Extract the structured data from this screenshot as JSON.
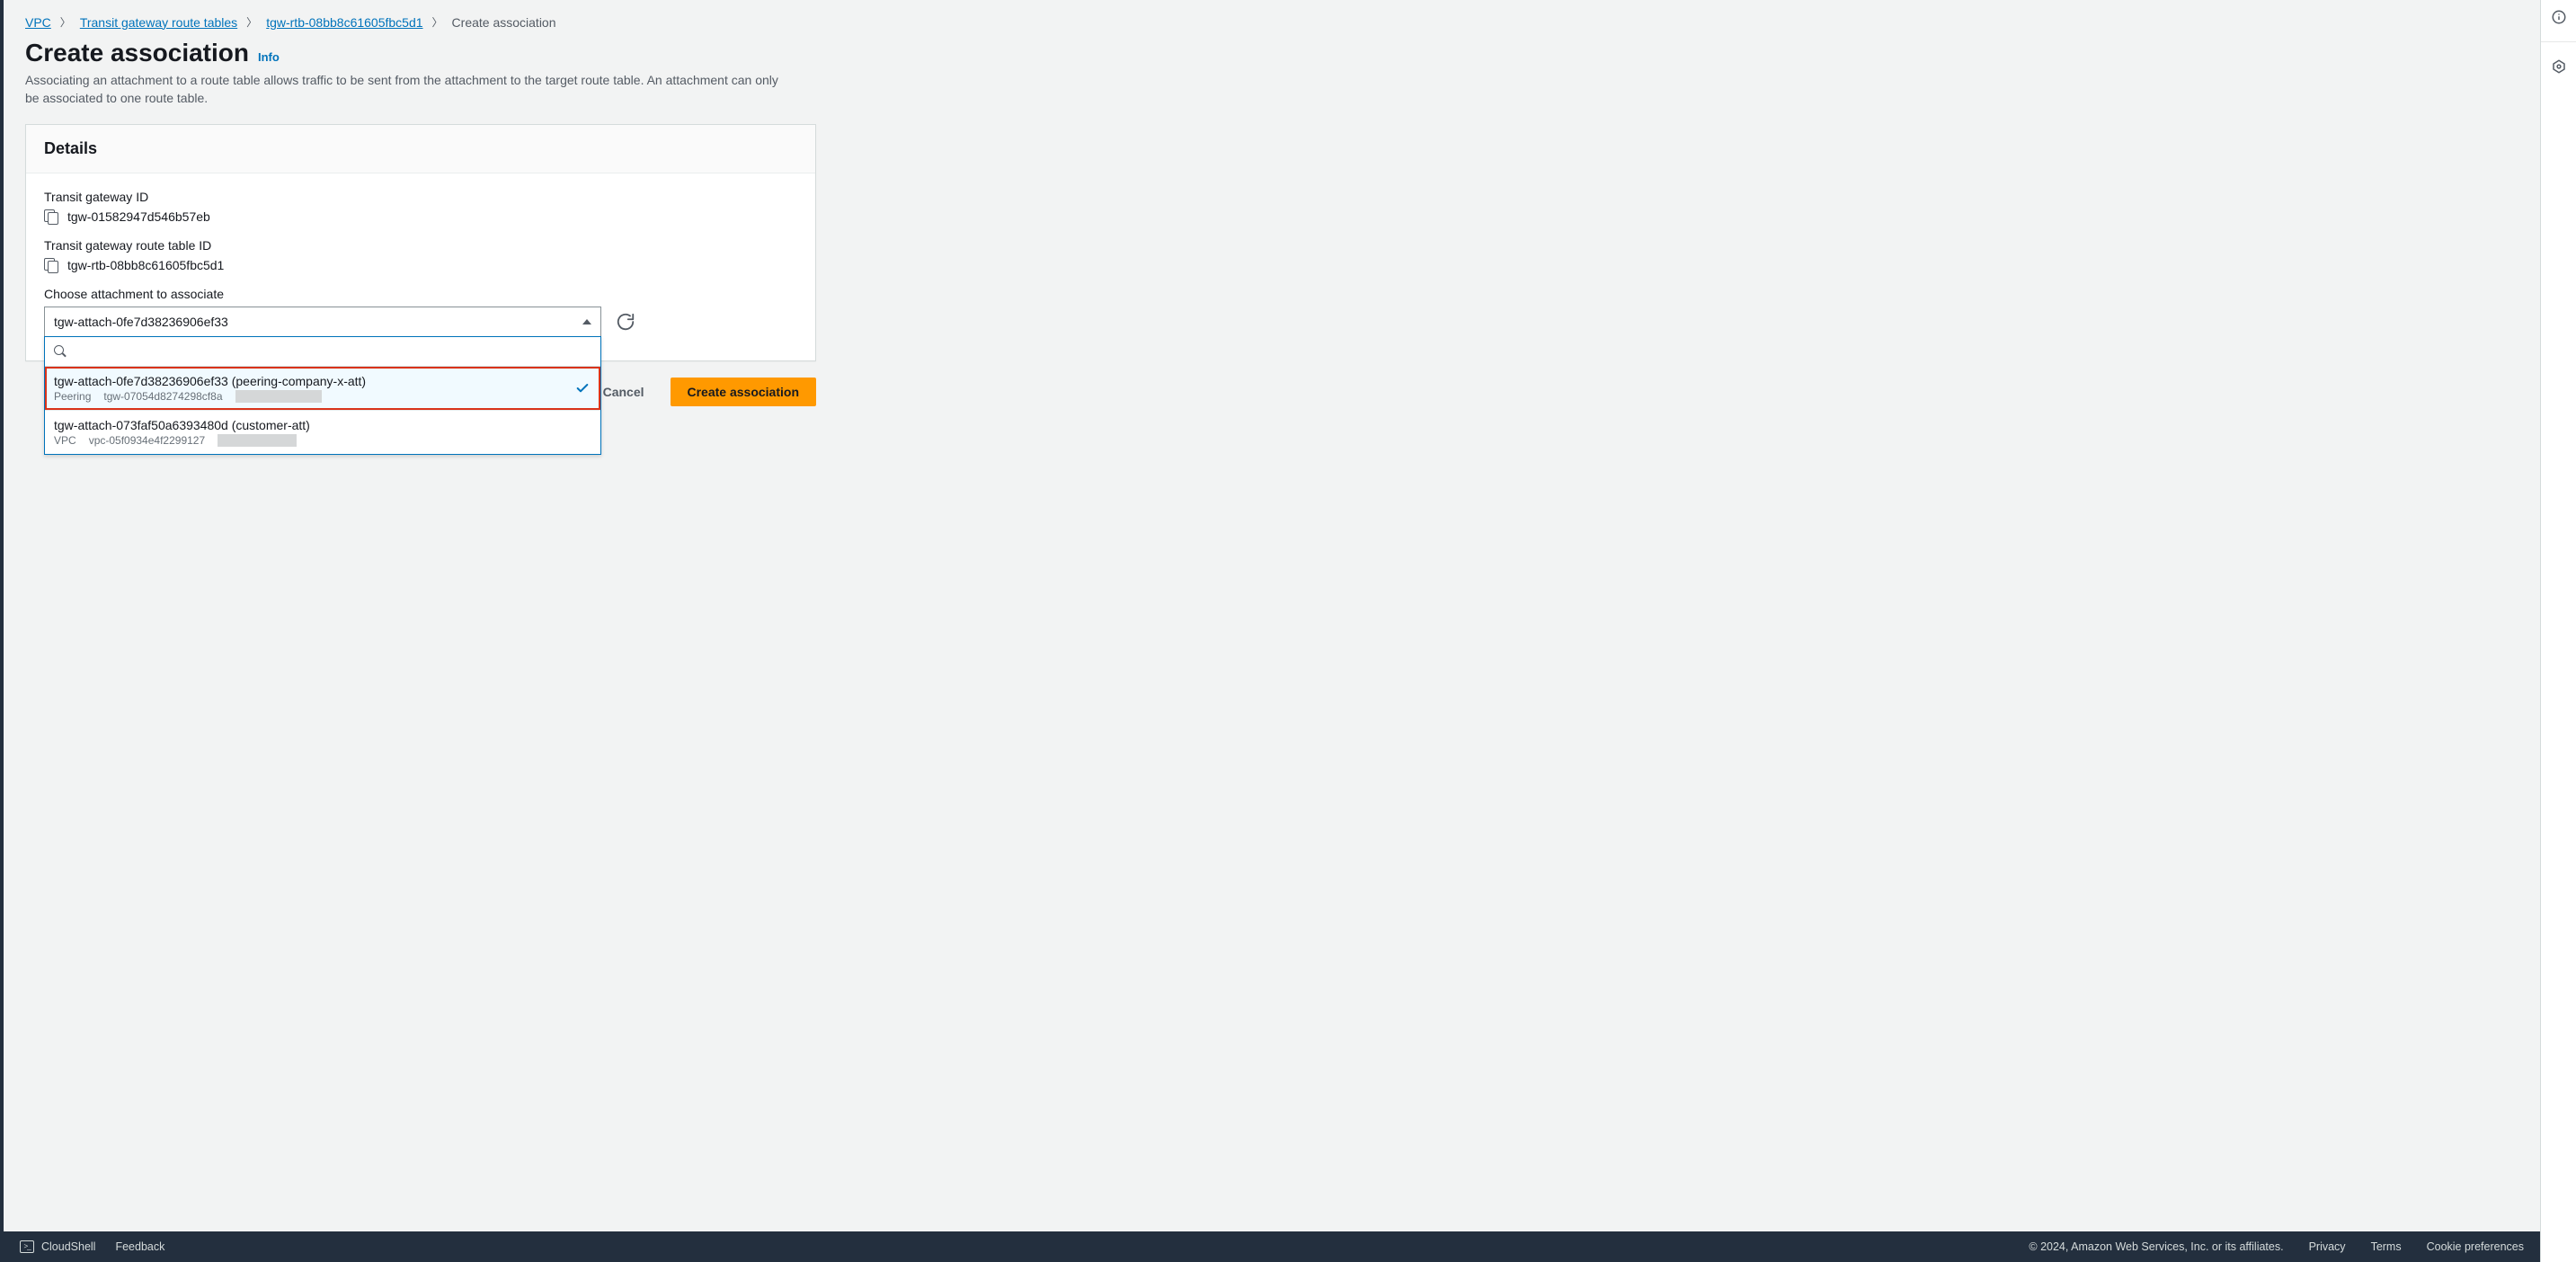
{
  "breadcrumb": {
    "vpc": "VPC",
    "tgrt": "Transit gateway route tables",
    "rtb": "tgw-rtb-08bb8c61605fbc5d1",
    "current": "Create association"
  },
  "page": {
    "title": "Create association",
    "info": "Info",
    "lead": "Associating an attachment to a route table allows traffic to be sent from the attachment to the target route table. An attachment can only be associated to one route table."
  },
  "panel": {
    "title": "Details",
    "tgw_id_label": "Transit gateway ID",
    "tgw_id_value": "tgw-01582947d546b57eb",
    "rtb_id_label": "Transit gateway route table ID",
    "rtb_id_value": "tgw-rtb-08bb8c61605fbc5d1",
    "choose_label": "Choose attachment to associate",
    "selected_value": "tgw-attach-0fe7d38236906ef33"
  },
  "dropdown": {
    "search_placeholder": "",
    "options": [
      {
        "title": "tgw-attach-0fe7d38236906ef33 (peering-company-x-att)",
        "type": "Peering",
        "resource": "tgw-07054d8274298cf8a",
        "selected": true,
        "highlight": true
      },
      {
        "title": "tgw-attach-073faf50a6393480d (customer-att)",
        "type": "VPC",
        "resource": "vpc-05f0934e4f2299127",
        "selected": false,
        "highlight": false
      }
    ]
  },
  "actions": {
    "cancel": "Cancel",
    "create": "Create association"
  },
  "footer": {
    "cloudshell": "CloudShell",
    "feedback": "Feedback",
    "copyright": "© 2024, Amazon Web Services, Inc. or its affiliates.",
    "privacy": "Privacy",
    "terms": "Terms",
    "cookies": "Cookie preferences"
  }
}
